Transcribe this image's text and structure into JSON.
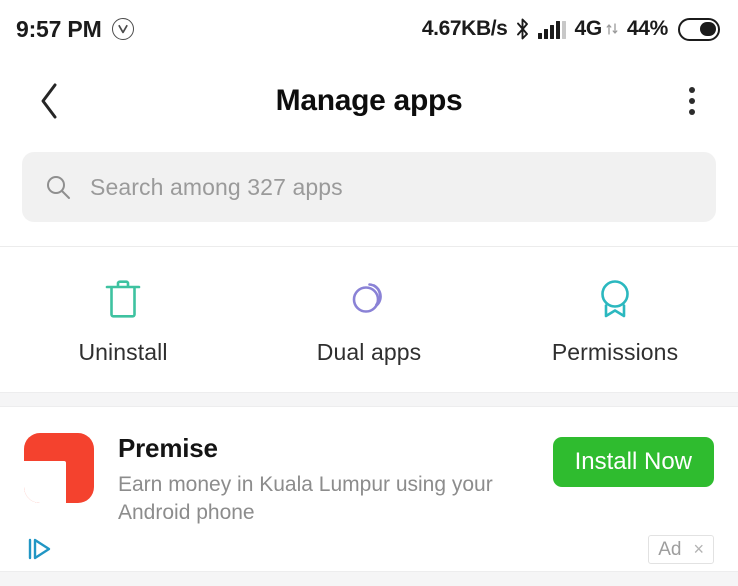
{
  "status_bar": {
    "time": "9:57 PM",
    "vpn_badge_icon": "circled-v-icon",
    "network_speed": "4.67KB/s",
    "bluetooth_icon": "bluetooth-icon",
    "signal_icon": "signal-bars-icon",
    "network_type": "4G",
    "data_arrows_icon": "data-transfer-arrows-icon",
    "battery_percent": "44%",
    "battery_icon": "battery-icon"
  },
  "app_bar": {
    "back_icon": "chevron-left-icon",
    "title": "Manage apps",
    "menu_icon": "more-vertical-icon"
  },
  "search": {
    "icon": "search-icon",
    "placeholder": "Search among 327 apps",
    "value": ""
  },
  "shortcuts": [
    {
      "label": "Uninstall",
      "icon": "trash-icon",
      "color": "#3ec2a0"
    },
    {
      "label": "Dual apps",
      "icon": "dual-circles-icon",
      "color": "#8a82d6"
    },
    {
      "label": "Permissions",
      "icon": "badge-ribbon-icon",
      "color": "#2bb8bf"
    }
  ],
  "ad": {
    "app_icon": "premise-app-icon",
    "app_icon_color": "#f4422e",
    "title": "Premise",
    "description": "Earn money in Kuala Lumpur using your Android phone",
    "cta_label": "Install Now",
    "cta_color": "#2fbc2f",
    "adchoices_icon": "adchoices-icon",
    "badge_label": "Ad",
    "close_label": "×"
  }
}
